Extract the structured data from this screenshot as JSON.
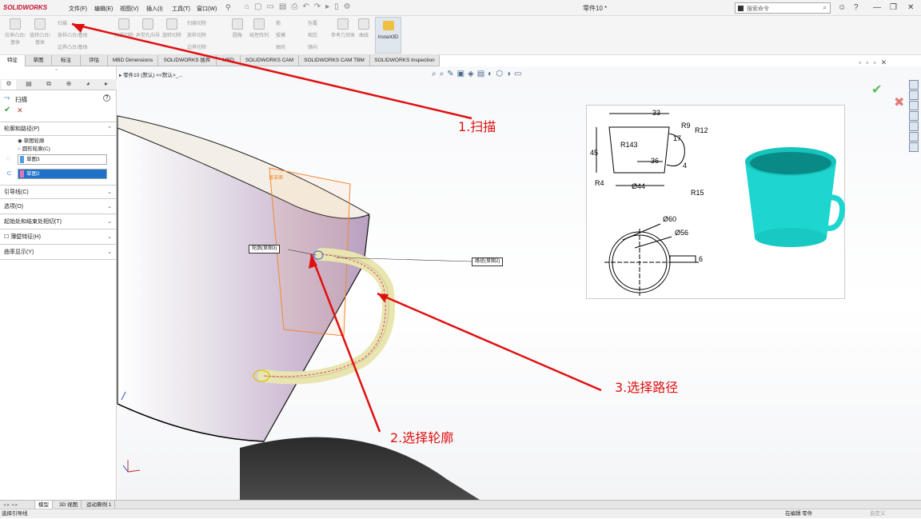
{
  "app": {
    "logo": "SOLIDWORKS",
    "doc_title": "零件10 *"
  },
  "menu": [
    "文件(F)",
    "编辑(E)",
    "视图(V)",
    "插入(I)",
    "工具(T)",
    "窗口(W)"
  ],
  "search": {
    "placeholder": "搜索命令"
  },
  "ribbon": {
    "big": [
      {
        "label": "拉伸凸台/基体"
      },
      {
        "label": "旋转凸台/基体"
      },
      {
        "label": "扫描切除"
      },
      {
        "label": "异型孔向导"
      },
      {
        "label": "旋转切除"
      },
      {
        "label": "圆角"
      },
      {
        "label": "线性阵列"
      },
      {
        "label": "筋"
      },
      {
        "label": "参考几何体"
      },
      {
        "label": "曲线"
      }
    ],
    "small": [
      "扫描",
      "放样凸台/基体",
      "边界凸台/基体",
      "扫描切除",
      "放样切除",
      "边界切除",
      "拔模",
      "抽壳",
      "包覆",
      "相交",
      "镜向"
    ],
    "instant3d": "Instant3D"
  },
  "tabs": [
    "特征",
    "草图",
    "标注",
    "评估",
    "MBD Dimensions",
    "SOLIDWORKS 插件",
    "MBD",
    "SOLIDWORKS CAM",
    "SOLIDWORKS CAM TBM",
    "SOLIDWORKS Inspection"
  ],
  "tree_line": "零件10 (默认) <<默认>_...",
  "panel": {
    "title": "扫描",
    "help": "?",
    "section_profile": "轮廓和路径(P)",
    "radio1": "草图轮廓",
    "radio2": "圆形轮廓(C)",
    "field_profile": "草图3",
    "field_path": "草图2",
    "sections": [
      "引导线(C)",
      "选项(O)",
      "起始处和结束处相切(T)",
      "薄壁特征(H)",
      "曲率显示(Y)"
    ]
  },
  "callouts": {
    "profile": "轮廓(草图3)",
    "path": "路径(草图2)"
  },
  "annotations": {
    "a1": "1.扫描",
    "a2": "2.选择轮廓",
    "a3": "3.选择路径"
  },
  "reference": {
    "dims": {
      "d33": "33",
      "d45": "45",
      "r143": "R143",
      "r9": "R9",
      "r12": "R12",
      "d17": "17",
      "d36": "36",
      "d4": "4",
      "r4": "R4",
      "d44": "Ø44",
      "r15": "R15",
      "d60": "Ø60",
      "d56": "Ø56",
      "d6": "6"
    }
  },
  "bottom_tabs": [
    "模型",
    "3D 视图",
    "运动算例 1"
  ],
  "status": {
    "left": "选择引导线",
    "right": "在编辑 零件",
    "custom": "自定义"
  },
  "colors": {
    "cup": "#e8dcea",
    "handle": "#f2f0c8",
    "ref_cup": "#1ee0d8",
    "arrow": "#e01010"
  }
}
